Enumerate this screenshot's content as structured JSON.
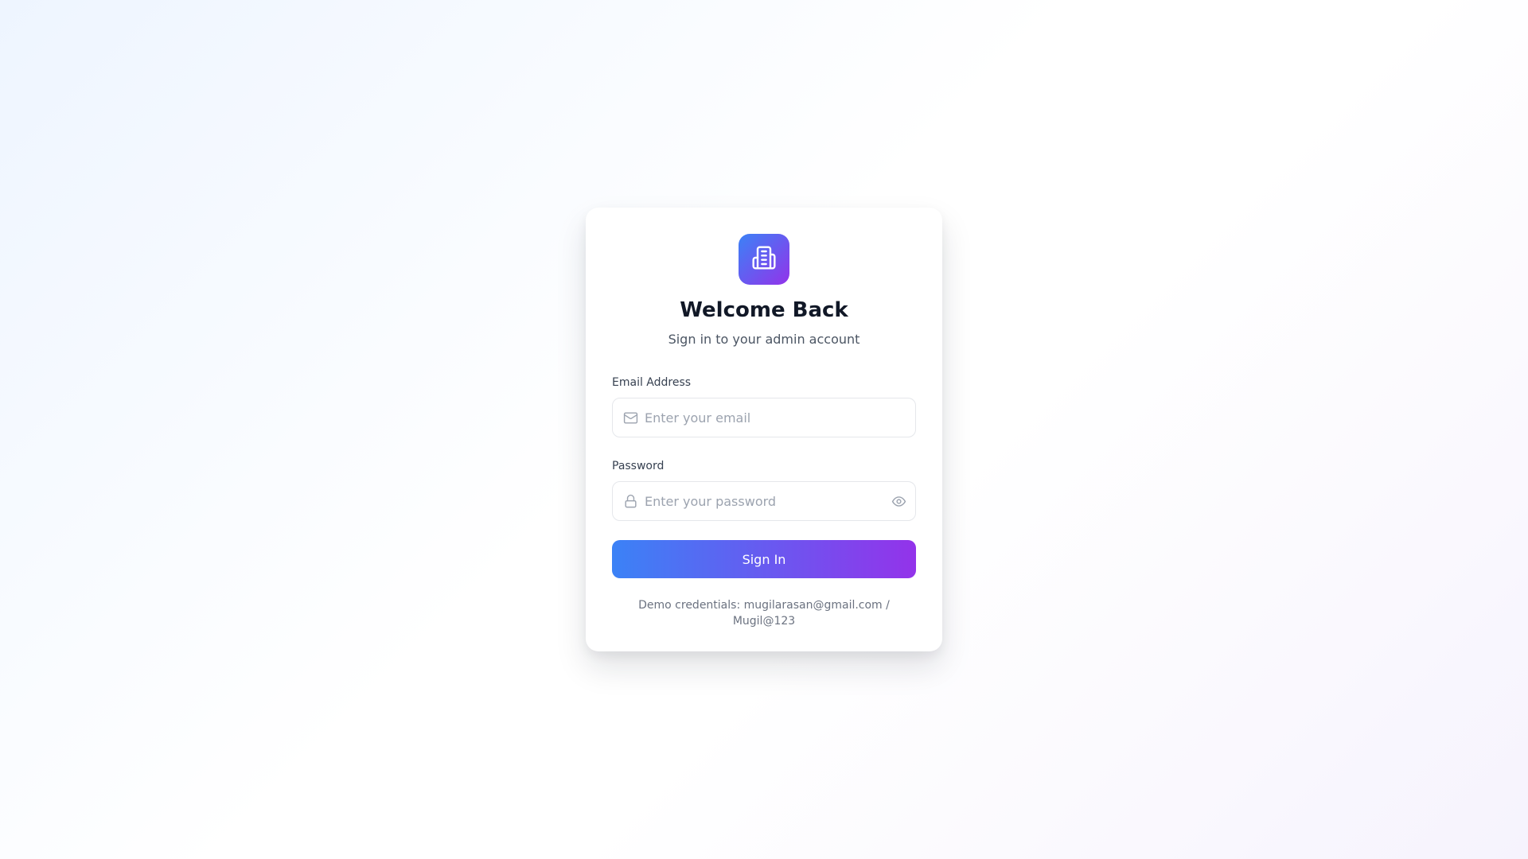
{
  "theme": {
    "gradient_start": "#3b82f6",
    "gradient_end": "#9333ea"
  },
  "card": {
    "logo_icon": "building-icon",
    "title": "Welcome Back",
    "subtitle": "Sign in to your admin account"
  },
  "form": {
    "email": {
      "label": "Email Address",
      "placeholder": "Enter your email",
      "value": "",
      "icon": "mail-icon"
    },
    "password": {
      "label": "Password",
      "placeholder": "Enter your password",
      "value": "",
      "icon": "lock-icon",
      "toggle_icon": "eye-icon"
    },
    "submit_label": "Sign In"
  },
  "demo": {
    "prefix": "Demo credentials: ",
    "email": "mugilarasan@gmail.com",
    "separator": " / ",
    "password": "Mugil@123"
  }
}
